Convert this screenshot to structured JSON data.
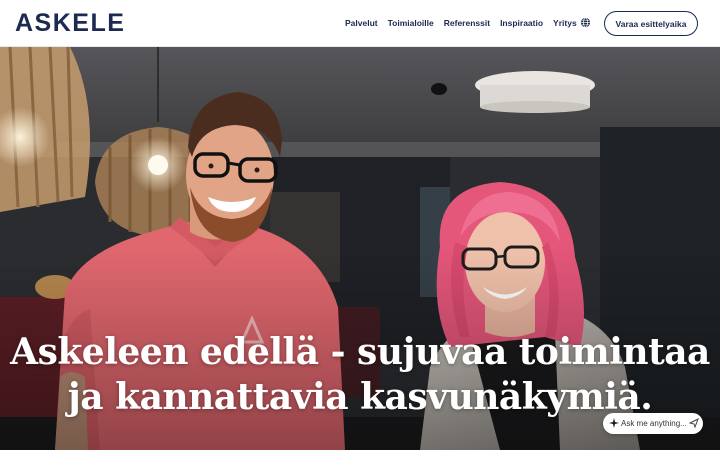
{
  "header": {
    "logo_text": "ASKELE",
    "nav": [
      {
        "label": "Palvelut"
      },
      {
        "label": "Toimialoille"
      },
      {
        "label": "Referenssit"
      },
      {
        "label": "Inspiraatio"
      },
      {
        "label": "Yritys"
      }
    ],
    "language_icon": "globe-icon",
    "cta_label": "Varaa esittelyaika"
  },
  "hero": {
    "headline_line1": "Askeleen edellä - sujuvaa toimintaa",
    "headline_line2": "ja kannattavia kasvunäkymiä."
  },
  "chat_widget": {
    "label": "Ask me anything...",
    "icon": "sparkle-icon",
    "send_icon": "send-icon"
  },
  "colors": {
    "brand_navy": "#1c2a52",
    "shirt_coral": "#e0676e",
    "hair_pink": "#e4567a"
  }
}
